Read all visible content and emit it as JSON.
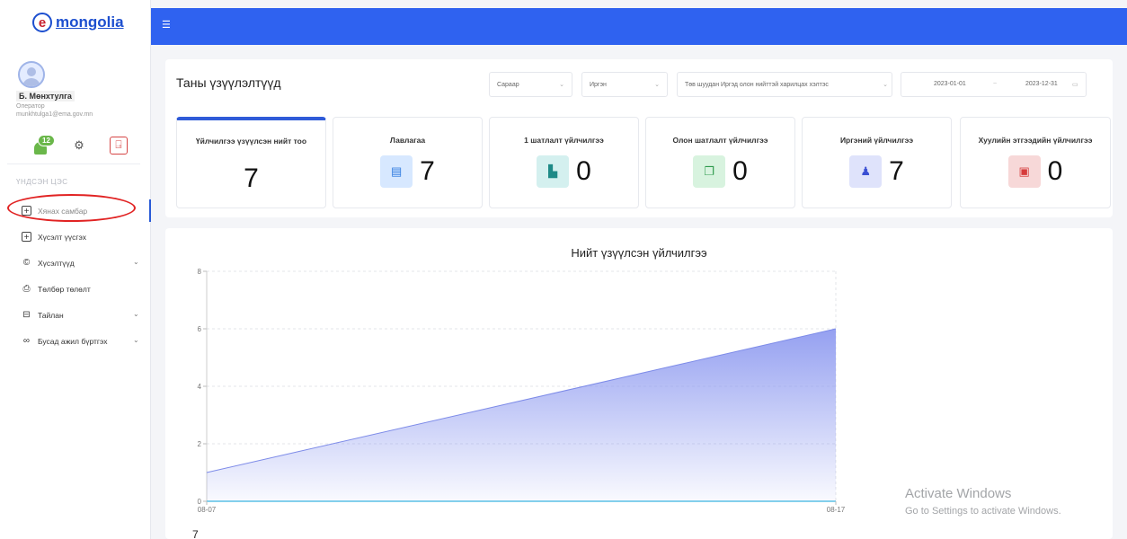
{
  "brand": {
    "logo_letter": "e",
    "logo_text": "mongolia"
  },
  "user": {
    "name": "Б. Мөнхтулга",
    "role": "Оператор",
    "email": "munkhtulga1@ema.gov.mn",
    "notification_count": "12"
  },
  "sidebar": {
    "section_title": "ҮНДСЭН ЦЭС",
    "items": [
      {
        "label": "Хянах самбар",
        "icon": "plus-box-icon"
      },
      {
        "label": "Хүсэлт үүсгэх",
        "icon": "plus-box-icon"
      },
      {
        "label": "Хүсэлтүүд",
        "icon": "document-icon"
      },
      {
        "label": "Төлбөр төлөлт",
        "icon": "cart-icon"
      },
      {
        "label": "Тайлан",
        "icon": "report-icon"
      },
      {
        "label": "Бусад ажил бүртгэх",
        "icon": "users-icon"
      }
    ]
  },
  "header": {
    "title": "Таны үзүүлэлтүүд",
    "filters": {
      "period": "Сараар",
      "type": "Иргэн",
      "channel": "Төв шуудан Иргэд олон нийттэй харилцах хэлтэс",
      "date_from": "2023-01-01",
      "date_sep": "~",
      "date_to": "2023-12-31"
    }
  },
  "stats": [
    {
      "label": "Үйлчилгээ үзүүлсэн нийт тоо",
      "value": "7"
    },
    {
      "label": "Лавлагаа",
      "value": "7",
      "icon": "document-icon",
      "color": "#d7e8ff",
      "icon_color": "#2f7be0"
    },
    {
      "label": "1 шатлалт үйлчилгээ",
      "value": "0",
      "icon": "file-icon",
      "color": "#d4f0ef",
      "icon_color": "#1e8a87"
    },
    {
      "label": "Олон шатлалт үйлчилгээ",
      "value": "0",
      "icon": "files-icon",
      "color": "#d8f3df",
      "icon_color": "#2d9a4c"
    },
    {
      "label": "Иргэний үйлчилгээ",
      "value": "7",
      "icon": "user-icon",
      "color": "#dfe3fb",
      "icon_color": "#3a4fd3"
    },
    {
      "label": "Хуулийн этгээдийн үйлчилгээ",
      "value": "0",
      "icon": "briefcase-icon",
      "color": "#f7d8d8",
      "icon_color": "#d63b3b"
    }
  ],
  "chart_data": {
    "type": "area",
    "title": "Нийт үзүүлсэн үйлчилгээ",
    "x": [
      "08-07",
      "08-17"
    ],
    "series": [
      {
        "values": [
          1,
          6
        ],
        "color": "#8f9bf0"
      },
      {
        "values": [
          0,
          0
        ],
        "color": "#5bc0e6"
      }
    ],
    "ylim": [
      0,
      8
    ],
    "yticks": [
      0,
      2,
      4,
      6,
      8
    ],
    "grid": true
  },
  "bottom_label": "7",
  "watermark": {
    "line1": "Activate Windows",
    "line2": "Go to Settings to activate Windows."
  }
}
